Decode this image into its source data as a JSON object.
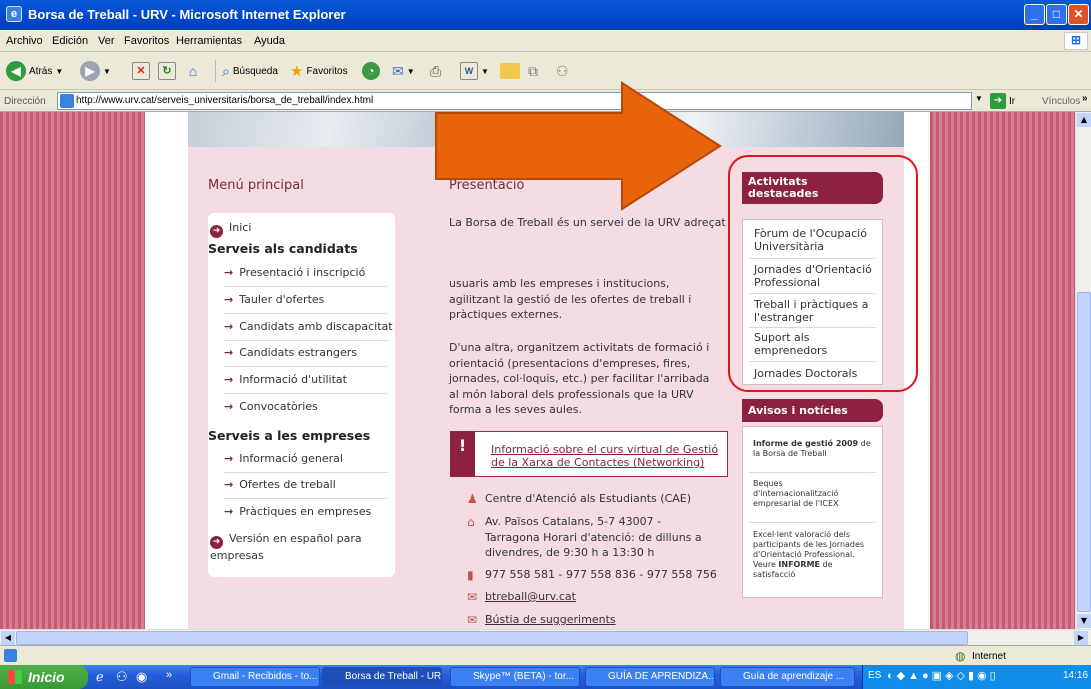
{
  "window": {
    "title": "Borsa de Treball - URV - Microsoft Internet Explorer"
  },
  "menu": [
    "Archivo",
    "Edición",
    "Ver",
    "Favoritos",
    "Herramientas",
    "Ayuda"
  ],
  "toolbar": {
    "back": "Atrás",
    "search": "Búsqueda",
    "favorites": "Favoritos"
  },
  "address": {
    "label": "Dirección",
    "url": "http://www.urv.cat/serveis_universitaris/borsa_de_treball/index.html",
    "go": "Ir",
    "links": "Vínculos"
  },
  "page": {
    "menu_title": "Menú principal",
    "menu": {
      "home": "Inici",
      "candidates_header": "Serveis als candidats",
      "candidates": [
        "Presentació i inscripció",
        "Tauler d'ofertes",
        "Candidats amb discapacitat",
        "Candidats estrangers",
        "Informació d'utilitat",
        "Convocatòries"
      ],
      "companies_header": "Serveis a les empreses",
      "companies": [
        "Informació general",
        "Ofertes de treball",
        "Pràctiques en empreses"
      ],
      "spanish": "Versión en español para empresas"
    },
    "presentation_title": "Presentació",
    "para1_line1": "La Borsa de Treball és un servei de la URV adreçat",
    "para1_rest": "usuaris amb les empreses i institucions, agilitzant la gestió de les ofertes de treball i pràctiques externes.",
    "para2": "D'una altra, organitzem activitats de formació i orientació (presentacions d'empreses, fires, jornades, col·loquis, etc.) per facilitar l'arribada al món laboral dels professionals que la URV forma a les seves aules.",
    "notice_link": "Informació sobre el curs virtual de Gestió de la Xarxa de Contactes (Networking)",
    "contact": {
      "center": "Centre d'Atenció als Estudiants (CAE)",
      "address": "Av. Països Catalans, 5-7 43007 - Tarragona Horari d'atenció: de dilluns a divendres, de 9:30 h a 13:30 h",
      "phones": "977 558 581 - 977 558 836 - 977 558 756",
      "email": "btreball@urv.cat",
      "suggestions": "Bústia de suggeriments"
    },
    "activities_title": "Activitats destacades",
    "activities": [
      "Fòrum de l'Ocupació Universitària",
      "Jornades d'Orientació Professional",
      "Treball i pràctiques a l'estranger",
      "Suport als emprenedors",
      "Jornades Doctorals"
    ],
    "news_title": "Avisos i notícies",
    "news": [
      {
        "bold": "Informe de gestió 2009",
        "text": " de la Borsa de Treball"
      },
      {
        "bold": "",
        "text": "Beques d'internacionalització empresarial de l'ICEX"
      },
      {
        "bold": "",
        "text": "Excel·lent valoració dels participants de les Jornades d'Orientació Professional. Veure "
      },
      {
        "bold": "INFORME",
        "text": " de satisfacció"
      }
    ]
  },
  "status": {
    "zone": "Internet"
  },
  "taskbar": {
    "start": "Inicio",
    "tasks": [
      "Gmail - Recibidos - to...",
      "Borsa de Treball - UR...",
      "Skype™ (BETA) - tor...",
      "GUÍA DE APRENDIZA...",
      "Guía de aprendizaje ..."
    ],
    "lang": "ES",
    "clock": "14:16"
  },
  "colors": {
    "accent": "#8c2240",
    "highlight_oval": "#e01616",
    "arrow": "#e8640a"
  }
}
